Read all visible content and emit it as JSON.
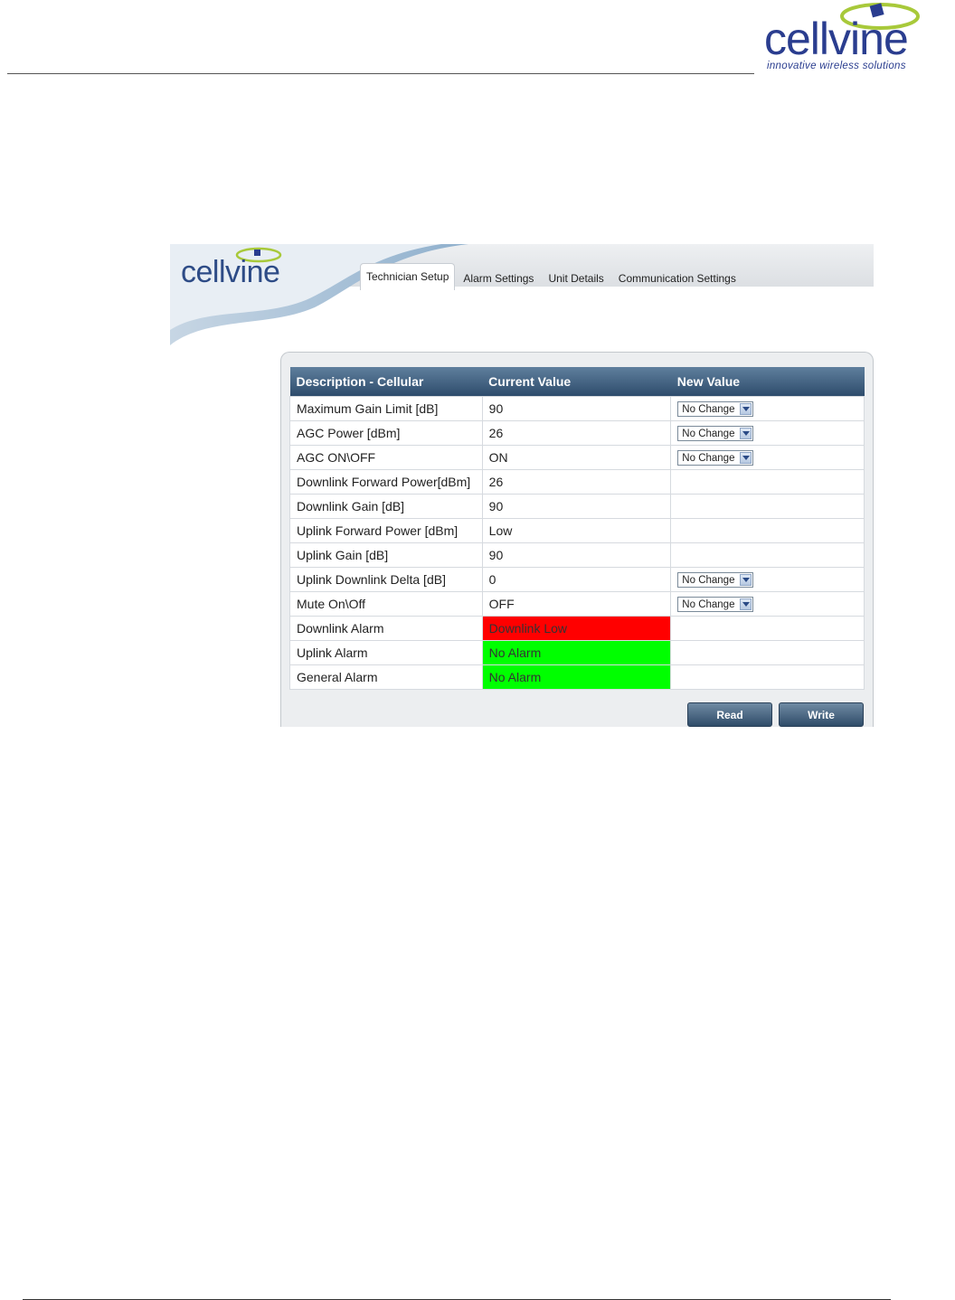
{
  "doc": {
    "logo_text": "cellvine",
    "tagline": "innovative wireless solutions"
  },
  "app": {
    "logo_text": "cellvine",
    "tabs": [
      {
        "label": "Technician Setup",
        "active": true
      },
      {
        "label": "Alarm Settings",
        "active": false
      },
      {
        "label": "Unit Details",
        "active": false
      },
      {
        "label": "Communication Settings",
        "active": false
      }
    ],
    "table": {
      "headers": [
        "Description - Cellular",
        "Current Value",
        "New Value"
      ],
      "rows": [
        {
          "description": "Maximum Gain Limit [dB]",
          "current": "90",
          "new": "No Change"
        },
        {
          "description": "AGC Power [dBm]",
          "current": "26",
          "new": "No Change"
        },
        {
          "description": "AGC ON\\OFF",
          "current": "ON",
          "new": "No Change"
        },
        {
          "description": "Downlink Forward Power[dBm]",
          "current": "26",
          "new": ""
        },
        {
          "description": "Downlink Gain [dB]",
          "current": "90",
          "new": ""
        },
        {
          "description": "Uplink Forward Power [dBm]",
          "current": "Low",
          "new": ""
        },
        {
          "description": "Uplink Gain [dB]",
          "current": "90",
          "new": ""
        },
        {
          "description": "Uplink Downlink Delta [dB]",
          "current": "0",
          "new": "No Change"
        },
        {
          "description": "Mute On\\Off",
          "current": "OFF",
          "new": "No Change"
        },
        {
          "description": "Downlink Alarm",
          "current": "Downlink Low",
          "new": "",
          "status": "red"
        },
        {
          "description": "Uplink Alarm",
          "current": "No Alarm",
          "new": "",
          "status": "green"
        },
        {
          "description": "General Alarm",
          "current": "No Alarm",
          "new": "",
          "status": "green"
        }
      ]
    },
    "buttons": {
      "read": "Read",
      "write": "Write"
    },
    "colors": {
      "header_dark": "#2e4c6c",
      "alarm_red": "#ff0000",
      "alarm_green": "#00ff00",
      "brand": "#2a3d8f"
    }
  }
}
